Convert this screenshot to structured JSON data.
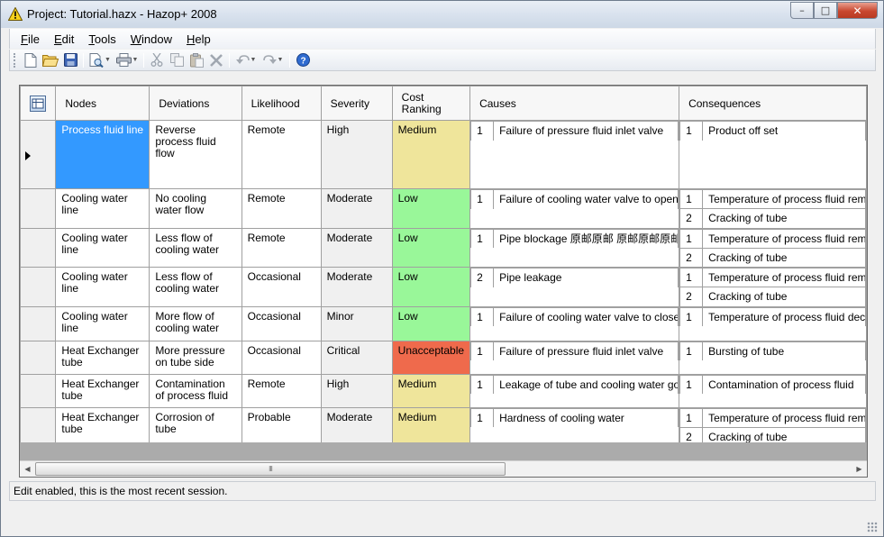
{
  "window": {
    "title": "Project: Tutorial.hazx - Hazop+ 2008",
    "controls": {
      "minimize": "–",
      "maximize": "□",
      "close": "✕"
    }
  },
  "menu": [
    {
      "label": "File",
      "accel": "F",
      "rest": "ile"
    },
    {
      "label": "Edit",
      "accel": "E",
      "rest": "dit"
    },
    {
      "label": "Tools",
      "accel": "T",
      "rest": "ools"
    },
    {
      "label": "Window",
      "accel": "W",
      "rest": "indow"
    },
    {
      "label": "Help",
      "accel": "H",
      "rest": "elp"
    }
  ],
  "toolbar": {
    "icons": [
      "new-icon",
      "open-icon",
      "save-icon",
      "print-preview-icon",
      "print-icon",
      "cut-icon",
      "copy-icon",
      "paste-icon",
      "delete-icon",
      "undo-icon",
      "redo-icon",
      "help-icon"
    ]
  },
  "grid": {
    "columns": [
      "Nodes",
      "Deviations",
      "Likelihood",
      "Severity",
      "Cost Ranking",
      "Causes",
      "Consequences"
    ],
    "rows": [
      {
        "node": "Process fluid line",
        "deviation": "Reverse process fluid flow",
        "likelihood": "Remote",
        "severity": "High",
        "cost": "Medium",
        "cost_level": "medium",
        "selected": true,
        "causes": [
          {
            "n": "1",
            "text": "Failure of pressure fluid inlet valve"
          }
        ],
        "consequences": [
          {
            "n": "1",
            "text": "Product off set"
          }
        ]
      },
      {
        "node": "Cooling water line",
        "deviation": "No cooling water flow",
        "likelihood": "Remote",
        "severity": "Moderate",
        "cost": "Low",
        "cost_level": "low",
        "causes": [
          {
            "n": "1",
            "text": "Failure of cooling water valve to open"
          }
        ],
        "consequences": [
          {
            "n": "1",
            "text": "Temperature of process fluid remains high"
          },
          {
            "n": "2",
            "text": "Cracking of tube"
          }
        ]
      },
      {
        "node": "Cooling water line",
        "deviation": "Less flow of cooling water",
        "likelihood": "Remote",
        "severity": "Moderate",
        "cost": "Low",
        "cost_level": "low",
        "causes": [
          {
            "n": "1",
            "text": "Pipe blockage 原邮原邮  原邮原邮原邮"
          }
        ],
        "consequences": [
          {
            "n": "1",
            "text": "Temperature of process fluid remains high"
          },
          {
            "n": "2",
            "text": "Cracking of tube"
          }
        ]
      },
      {
        "node": "Cooling water line",
        "deviation": "Less flow of cooling water",
        "likelihood": "Occasional",
        "severity": "Moderate",
        "cost": "Low",
        "cost_level": "low",
        "causes": [
          {
            "n": "2",
            "text": "Pipe leakage"
          }
        ],
        "consequences": [
          {
            "n": "1",
            "text": "Temperature of process fluid remains high"
          },
          {
            "n": "2",
            "text": "Cracking of tube"
          }
        ]
      },
      {
        "node": "Cooling water line",
        "deviation": "More flow of cooling water",
        "likelihood": "Occasional",
        "severity": "Minor",
        "cost": "Low",
        "cost_level": "low",
        "causes": [
          {
            "n": "1",
            "text": "Failure of cooling water valve to close"
          }
        ],
        "consequences": [
          {
            "n": "1",
            "text": "Temperature of process fluid decreases"
          }
        ]
      },
      {
        "node": "Heat Exchanger tube",
        "deviation": "More pressure on tube side",
        "likelihood": "Occasional",
        "severity": "Critical",
        "cost": "Unacceptable",
        "cost_level": "unacceptable",
        "causes": [
          {
            "n": "1",
            "text": "Failure of pressure fluid inlet valve"
          }
        ],
        "consequences": [
          {
            "n": "1",
            "text": "Bursting of tube"
          }
        ]
      },
      {
        "node": "Heat Exchanger tube",
        "deviation": "Contamination of process fluid",
        "likelihood": "Remote",
        "severity": "High",
        "cost": "Medium",
        "cost_level": "medium",
        "causes": [
          {
            "n": "1",
            "text": "Leakage of tube and cooling water goes in"
          }
        ],
        "consequences": [
          {
            "n": "1",
            "text": "Contamination of process fluid"
          }
        ]
      },
      {
        "node": "Heat Exchanger tube",
        "deviation": "Corrosion of tube",
        "likelihood": "Probable",
        "severity": "Moderate",
        "cost": "Medium",
        "cost_level": "medium",
        "causes": [
          {
            "n": "1",
            "text": "Hardness of cooling water"
          }
        ],
        "consequences": [
          {
            "n": "1",
            "text": "Temperature of process fluid remains high"
          },
          {
            "n": "2",
            "text": "Cracking of tube"
          }
        ]
      }
    ]
  },
  "scrollbar": {
    "grip": "III"
  },
  "status": {
    "text": "Edit enabled, this is the most recent session."
  },
  "colors": {
    "selected": "#3399ff",
    "medium": "#efe59b",
    "low": "#99f799",
    "unacceptable": "#ef6a4c"
  }
}
